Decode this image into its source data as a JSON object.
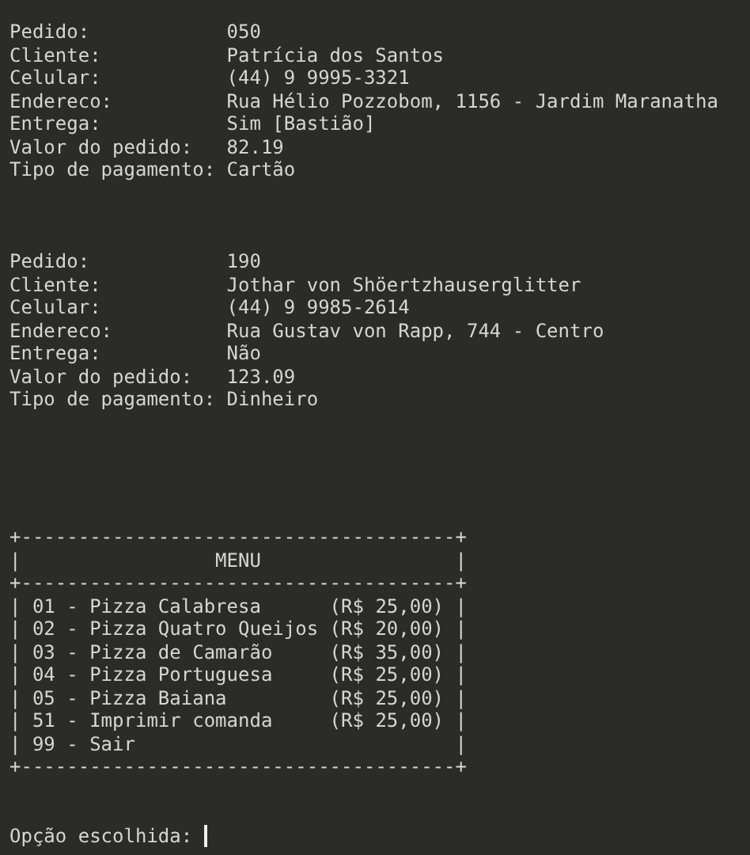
{
  "orders": [
    {
      "fields": [
        {
          "label": "Pedido:",
          "value": "050"
        },
        {
          "label": "Cliente:",
          "value": "Patrícia dos Santos"
        },
        {
          "label": "Celular:",
          "value": "(44) 9 9995-3321"
        },
        {
          "label": "Endereco:",
          "value": "Rua Hélio Pozzobom, 1156 - Jardim Maranatha"
        },
        {
          "label": "Entrega:",
          "value": "Sim [Bastião]"
        },
        {
          "label": "Valor do pedido:",
          "value": "82.19"
        },
        {
          "label": "Tipo de pagamento:",
          "value": "Cartão"
        }
      ]
    },
    {
      "fields": [
        {
          "label": "Pedido:",
          "value": "190"
        },
        {
          "label": "Cliente:",
          "value": "Jothar von Shöertzhauserglitter"
        },
        {
          "label": "Celular:",
          "value": "(44) 9 9985-2614"
        },
        {
          "label": "Endereco:",
          "value": "Rua Gustav von Rapp, 744 - Centro"
        },
        {
          "label": "Entrega:",
          "value": "Não"
        },
        {
          "label": "Valor do pedido:",
          "value": "123.09"
        },
        {
          "label": "Tipo de pagamento:",
          "value": "Dinheiro"
        }
      ]
    }
  ],
  "menu_lines": [
    "+--------------------------------------+",
    "|                 MENU                 |",
    "+--------------------------------------+",
    "| 01 - Pizza Calabresa      (R$ 25,00) |",
    "| 02 - Pizza Quatro Queijos (R$ 20,00) |",
    "| 03 - Pizza de Camarão     (R$ 35,00) |",
    "| 04 - Pizza Portuguesa     (R$ 25,00) |",
    "| 05 - Pizza Baiana         (R$ 25,00) |",
    "| 51 - Imprimir comanda     (R$ 25,00) |",
    "| 99 - Sair                            |",
    "+--------------------------------------+"
  ],
  "prompt": "Opção escolhida:"
}
